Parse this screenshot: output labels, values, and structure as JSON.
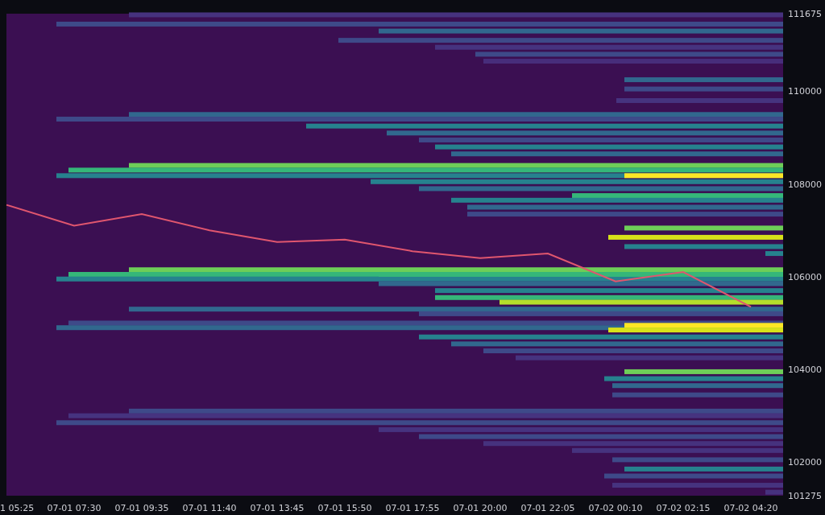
{
  "chart": {
    "chart_data": {
      "type": "line",
      "x": [
        "1 05:25",
        "07-01 07:30",
        "07-01 09:35",
        "07-01 11:40",
        "07-01 13:45",
        "07-01 15:50",
        "07-01 17:55",
        "07-01 20:00",
        "07-01 22:05",
        "07-02 00:10",
        "07-02 02:15",
        "07-02 04:20"
      ],
      "ylim": [
        101275,
        111675
      ],
      "yticks": [
        {
          "value": 111675,
          "label": "111675"
        },
        {
          "value": 110000,
          "label": "110000"
        },
        {
          "value": 108000,
          "label": "108000"
        },
        {
          "value": 106000,
          "label": "106000"
        },
        {
          "value": 104000,
          "label": "104000"
        },
        {
          "value": 102000,
          "label": "102000"
        },
        {
          "value": 101275,
          "label": "101275"
        }
      ],
      "series": [
        {
          "color": "#e0566e",
          "values": [
            107550,
            107100,
            107350,
            107000,
            106750,
            106800,
            106550,
            106400,
            106500,
            105900,
            106100,
            105350
          ]
        }
      ]
    }
  }
}
